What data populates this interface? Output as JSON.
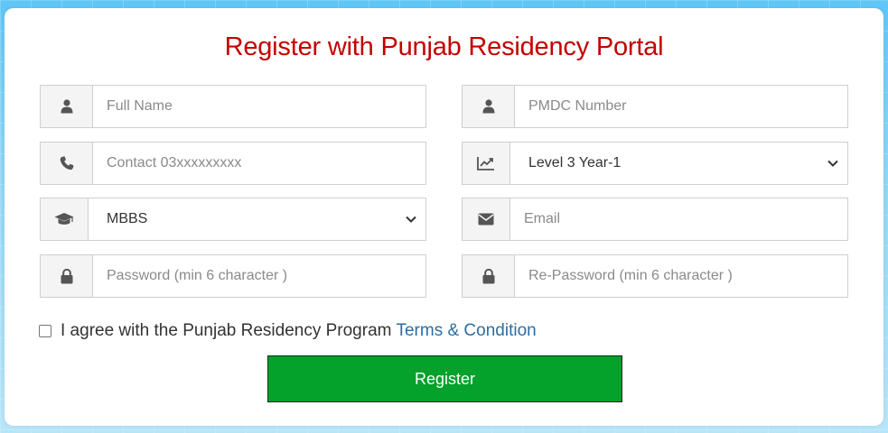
{
  "form": {
    "title": "Register with Punjab Residency Portal",
    "full_name": {
      "placeholder": "Full Name",
      "icon": "user-icon"
    },
    "pmdc_number": {
      "placeholder": "PMDC Number",
      "icon": "user-icon"
    },
    "contact": {
      "placeholder": "Contact 03xxxxxxxxx",
      "icon": "phone-icon"
    },
    "level": {
      "selected": "Level 3 Year-1",
      "icon": "line-chart-icon"
    },
    "degree": {
      "selected": "MBBS",
      "icon": "graduation-cap-icon"
    },
    "email": {
      "placeholder": "Email",
      "icon": "envelope-icon"
    },
    "password": {
      "placeholder": "Password (min 6 character )",
      "icon": "lock-icon"
    },
    "repassword": {
      "placeholder": "Re-Password (min 6 character )",
      "icon": "lock-icon"
    },
    "agree_text": "I agree with the Punjab Residency Program",
    "terms_link": "Terms & Condition",
    "register_label": "Register"
  },
  "colors": {
    "title": "#c40000",
    "button": "#04a12b",
    "link": "#2d6da3",
    "background": "#5fc6f5"
  }
}
